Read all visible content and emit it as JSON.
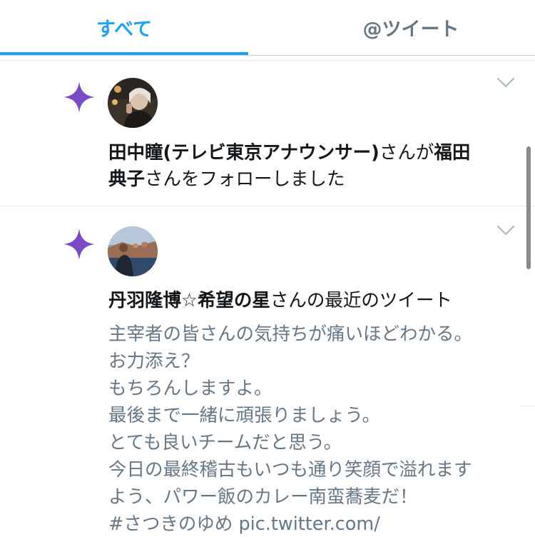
{
  "tabs": {
    "all": "すべて",
    "mentions": "@ツイート"
  },
  "notifications": [
    {
      "type": "follow",
      "icon": "sparkle-icon",
      "icon_color": "#794bc4",
      "actor": "田中瞳(テレビ東京アナウンサー)",
      "mid": "さんが",
      "target_line1": "福田",
      "target_line2": "典子",
      "suffix": "さんをフォローしました"
    },
    {
      "type": "recent_tweet",
      "icon": "sparkle-icon",
      "icon_color": "#794bc4",
      "actor": "丹羽隆博☆希望の星",
      "suffix": "さんの最近のツイート",
      "tweet_lines": [
        "主宰者の皆さんの気持ちが痛いほどわかる。",
        "お力添え？",
        "もちろんしますよ。",
        "最後まで一緒に頑張りましょう。",
        "とても良いチームだと思う。",
        "今日の最終稽古もいつも通り笑顔で溢れます",
        "よう、パワー飯のカレー南蛮蕎麦だ！",
        "#さつきのゆめ pic.twitter.com/"
      ]
    }
  ],
  "colors": {
    "accent": "#1da1f2",
    "secondary_text": "#657786",
    "sparkle": "#794bc4"
  }
}
